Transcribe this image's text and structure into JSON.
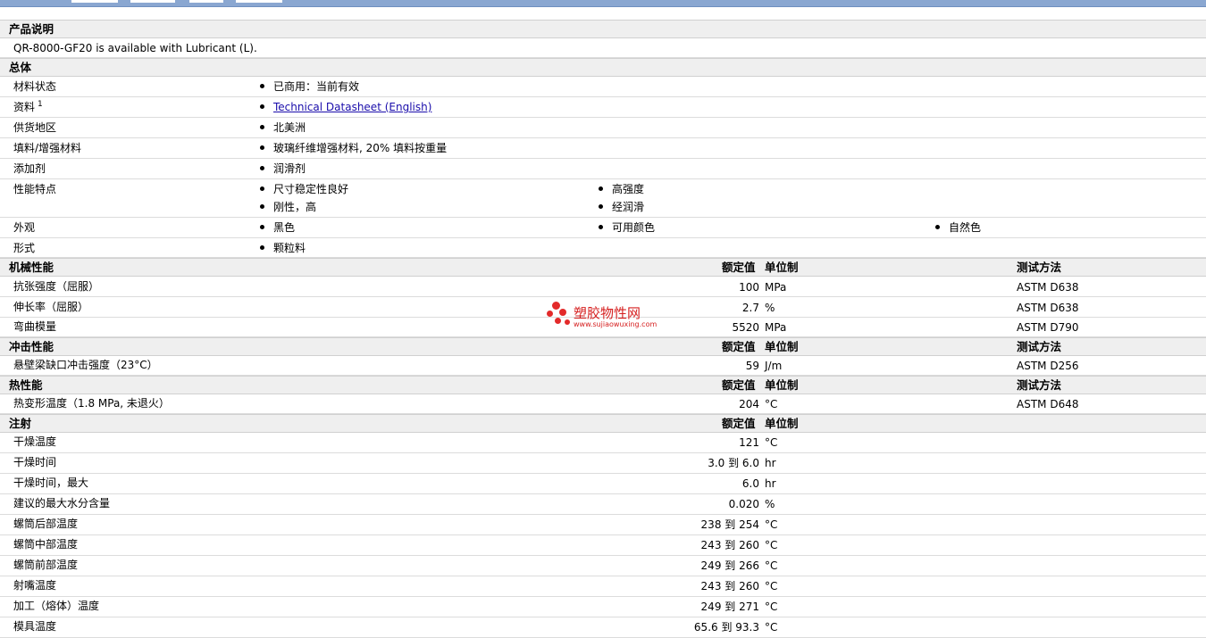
{
  "sections": {
    "desc": "产品说明",
    "general": "总体",
    "mech": "机械性能",
    "impact": "冲击性能",
    "thermal": "热性能",
    "injection": "注射"
  },
  "description": "QR-8000-GF20 is available with Lubricant (L).",
  "headers": {
    "value": "额定值",
    "unit": "单位制",
    "method": "测试方法"
  },
  "general": {
    "status_label": "材料状态",
    "status": "已商用：当前有效",
    "doc_label": "资料",
    "doc_sup": "1",
    "doc_link": "Technical Datasheet (English)",
    "region_label": "供货地区",
    "region": "北美洲",
    "filler_label": "填料/增强材料",
    "filler": "玻璃纤维增强材料, 20% 填料按重量",
    "additive_label": "添加剂",
    "additive": "润滑剂",
    "features_label": "性能特点",
    "features": [
      "尺寸稳定性良好",
      "高强度",
      "刚性，高",
      "经润滑"
    ],
    "appearance_label": "外观",
    "appearance": [
      "黑色",
      "可用颜色",
      "自然色"
    ],
    "form_label": "形式",
    "form": "颗粒料"
  },
  "mechanical": [
    {
      "name": "抗张强度（屈服）",
      "value": "100",
      "unit": "MPa",
      "method": "ASTM D638"
    },
    {
      "name": "伸长率（屈服）",
      "value": "2.7",
      "unit": "%",
      "method": "ASTM D638"
    },
    {
      "name": "弯曲模量",
      "value": "5520",
      "unit": "MPa",
      "method": "ASTM D790"
    }
  ],
  "impact": [
    {
      "name": "悬壁梁缺口冲击强度（23°C）",
      "value": "59",
      "unit": "J/m",
      "method": "ASTM D256"
    }
  ],
  "thermal": [
    {
      "name": "热变形温度（1.8 MPa, 未退火）",
      "value": "204",
      "unit": "°C",
      "method": "ASTM D648"
    }
  ],
  "injection": [
    {
      "name": "干燥温度",
      "value": "121",
      "unit": "°C"
    },
    {
      "name": "干燥时间",
      "value": "3.0 到  6.0",
      "unit": "hr"
    },
    {
      "name": "干燥时间，最大",
      "value": "6.0",
      "unit": "hr"
    },
    {
      "name": "建议的最大水分含量",
      "value": "0.020",
      "unit": "%"
    },
    {
      "name": "螺筒后部温度",
      "value": "238 到  254",
      "unit": "°C"
    },
    {
      "name": "螺筒中部温度",
      "value": "243 到  260",
      "unit": "°C"
    },
    {
      "name": "螺筒前部温度",
      "value": "249 到  266",
      "unit": "°C"
    },
    {
      "name": "射嘴温度",
      "value": "243 到  260",
      "unit": "°C"
    },
    {
      "name": "加工（熔体）温度",
      "value": "249 到  271",
      "unit": "°C"
    },
    {
      "name": "模具温度",
      "value": "65.6 到  93.3",
      "unit": "°C"
    }
  ],
  "watermark": {
    "text": "塑胶物性网",
    "url": "www.sujiaowuxing.com"
  }
}
